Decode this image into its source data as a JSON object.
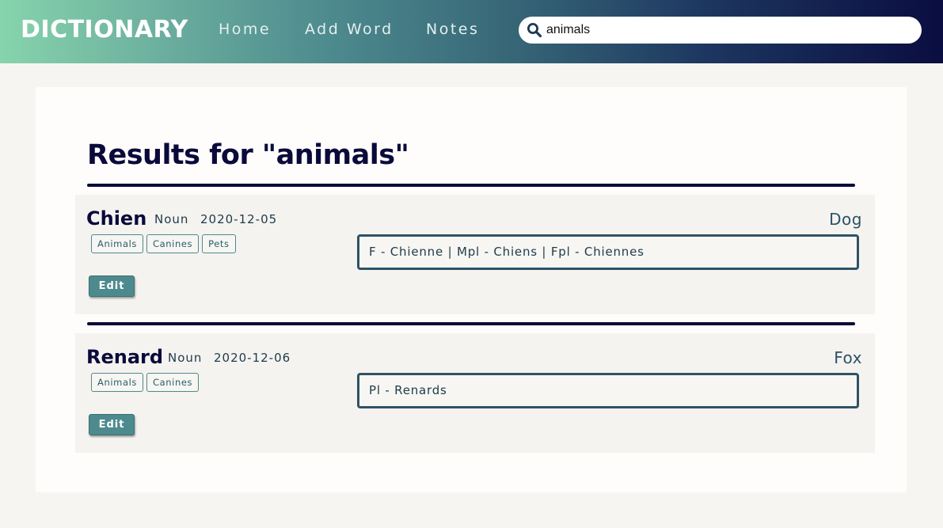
{
  "header": {
    "brand": "DICTIONARY",
    "nav": [
      {
        "label": "Home"
      },
      {
        "label": "Add Word"
      },
      {
        "label": "Notes"
      }
    ],
    "search": {
      "value": "animals",
      "icon": "search-icon"
    }
  },
  "results": {
    "title": "Results for \"animals\"",
    "entries": [
      {
        "word": "Chien",
        "pos": "Noun",
        "date": "2020-12-05",
        "translation": "Dog",
        "tags": [
          "Animals",
          "Canines",
          "Pets"
        ],
        "forms": "F - Chienne | Mpl - Chiens | Fpl - Chiennes",
        "edit_label": "Edit"
      },
      {
        "word": "Renard",
        "pos": "Noun",
        "date": "2020-12-06",
        "translation": "Fox",
        "tags": [
          "Animals",
          "Canines"
        ],
        "forms": "Pl - Renards",
        "edit_label": "Edit"
      }
    ]
  },
  "colors": {
    "navy": "#0a0a3a",
    "teal": "#4d8a8e",
    "gradient_start": "#86d4ac",
    "gradient_end": "#0a0d40"
  }
}
